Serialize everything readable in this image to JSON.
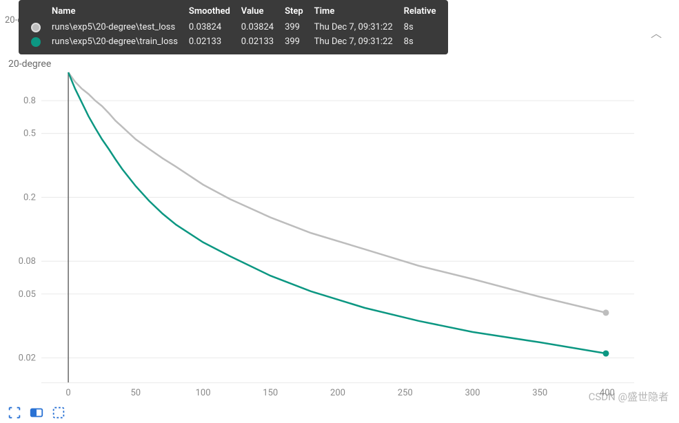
{
  "title_bg": "20-degree",
  "subtitle": "20-degree",
  "tooltip": {
    "headers": [
      "",
      "Name",
      "Smoothed",
      "Value",
      "Step",
      "Time",
      "Relative"
    ],
    "rows": [
      {
        "color": "#bdbdbd",
        "name": "runs\\exp5\\20-degree\\test_loss",
        "smoothed": "0.03824",
        "value": "0.03824",
        "step": "399",
        "time": "Thu Dec 7, 09:31:22",
        "relative": "8s"
      },
      {
        "color": "#0c9782",
        "name": "runs\\exp5\\20-degree\\train_loss",
        "smoothed": "0.02133",
        "value": "0.02133",
        "step": "399",
        "time": "Thu Dec 7, 09:31:22",
        "relative": "8s"
      }
    ]
  },
  "watermark": "CSDN @盛世隐者",
  "chart_data": {
    "type": "line",
    "title": "20-degree",
    "xlabel": "",
    "ylabel": "",
    "xlim": [
      -20,
      420
    ],
    "ylim_log": [
      0.014,
      1.2
    ],
    "yticks": [
      0.02,
      0.05,
      0.08,
      0.2,
      0.5,
      0.8
    ],
    "xticks": [
      0,
      50,
      100,
      150,
      200,
      250,
      300,
      350,
      400
    ],
    "cursor_x": 0,
    "series": [
      {
        "name": "test_loss",
        "color": "#bdbdbd",
        "end_marker": true,
        "x": [
          0,
          5,
          10,
          15,
          20,
          25,
          30,
          35,
          40,
          50,
          60,
          70,
          80,
          100,
          120,
          150,
          180,
          220,
          260,
          300,
          350,
          399
        ],
        "y": [
          1.2,
          1.05,
          0.95,
          0.88,
          0.8,
          0.74,
          0.67,
          0.6,
          0.55,
          0.46,
          0.4,
          0.35,
          0.31,
          0.24,
          0.195,
          0.15,
          0.12,
          0.095,
          0.075,
          0.062,
          0.048,
          0.03824
        ]
      },
      {
        "name": "train_loss",
        "color": "#0c9782",
        "end_marker": true,
        "x": [
          0,
          5,
          10,
          15,
          20,
          25,
          30,
          35,
          40,
          50,
          60,
          70,
          80,
          100,
          120,
          150,
          180,
          220,
          260,
          300,
          350,
          399
        ],
        "y": [
          1.2,
          0.95,
          0.78,
          0.64,
          0.54,
          0.46,
          0.4,
          0.345,
          0.3,
          0.235,
          0.19,
          0.158,
          0.135,
          0.105,
          0.086,
          0.065,
          0.052,
          0.041,
          0.034,
          0.029,
          0.025,
          0.02133
        ]
      }
    ]
  }
}
